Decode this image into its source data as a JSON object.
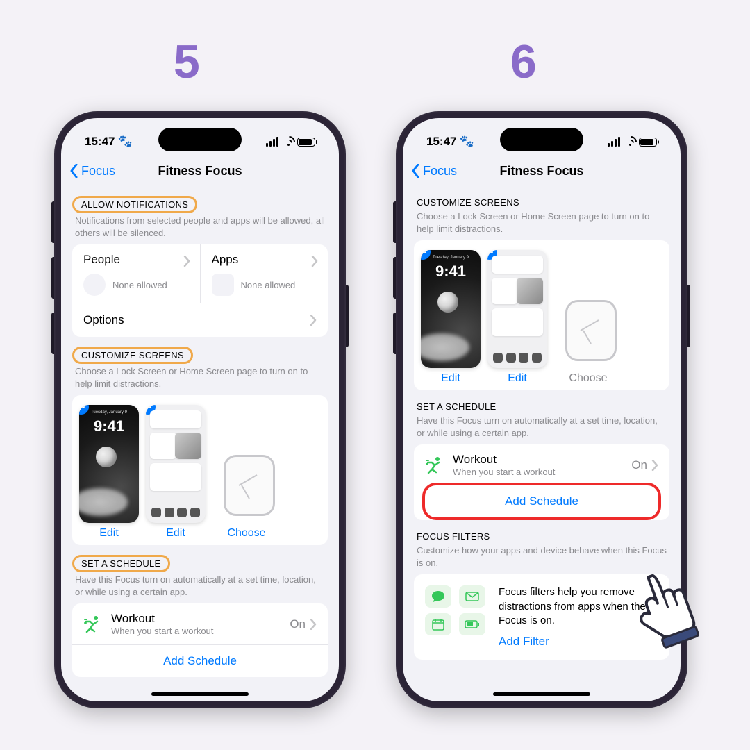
{
  "steps": {
    "five": "5",
    "six": "6"
  },
  "status": {
    "time": "15:47",
    "paw": "🐾"
  },
  "nav": {
    "back": "Focus",
    "title": "Fitness Focus"
  },
  "p5": {
    "allow": {
      "header": "ALLOW NOTIFICATIONS",
      "sub": "Notifications from selected people and apps will be allowed, all others will be silenced.",
      "people": "People",
      "apps": "Apps",
      "none": "None allowed",
      "options": "Options"
    },
    "customize": {
      "header": "CUSTOMIZE SCREENS",
      "sub": "Choose a Lock Screen or Home Screen page to turn on to help limit distractions.",
      "edit": "Edit",
      "choose": "Choose",
      "lockTime": "9:41",
      "lockDate": "Tuesday, January 9"
    },
    "schedule": {
      "header": "SET A SCHEDULE",
      "sub": "Have this Focus turn on automatically at a set time, location, or while using a certain app.",
      "workout": "Workout",
      "workoutSub": "When you start a workout",
      "on": "On",
      "add": "Add Schedule"
    }
  },
  "p6": {
    "customize": {
      "header": "CUSTOMIZE SCREENS",
      "sub": "Choose a Lock Screen or Home Screen page to turn on to help limit distractions.",
      "edit": "Edit",
      "choose": "Choose",
      "lockTime": "9:41",
      "lockDate": "Tuesday, January 9"
    },
    "schedule": {
      "header": "SET A SCHEDULE",
      "sub": "Have this Focus turn on automatically at a set time, location, or while using a certain app.",
      "workout": "Workout",
      "workoutSub": "When you start a workout",
      "on": "On",
      "add": "Add Schedule"
    },
    "filters": {
      "header": "FOCUS FILTERS",
      "sub": "Customize how your apps and device behave when this Focus is on.",
      "desc": "Focus filters help you remove distractions from apps when the Focus is on.",
      "add": "Add Filter"
    }
  }
}
